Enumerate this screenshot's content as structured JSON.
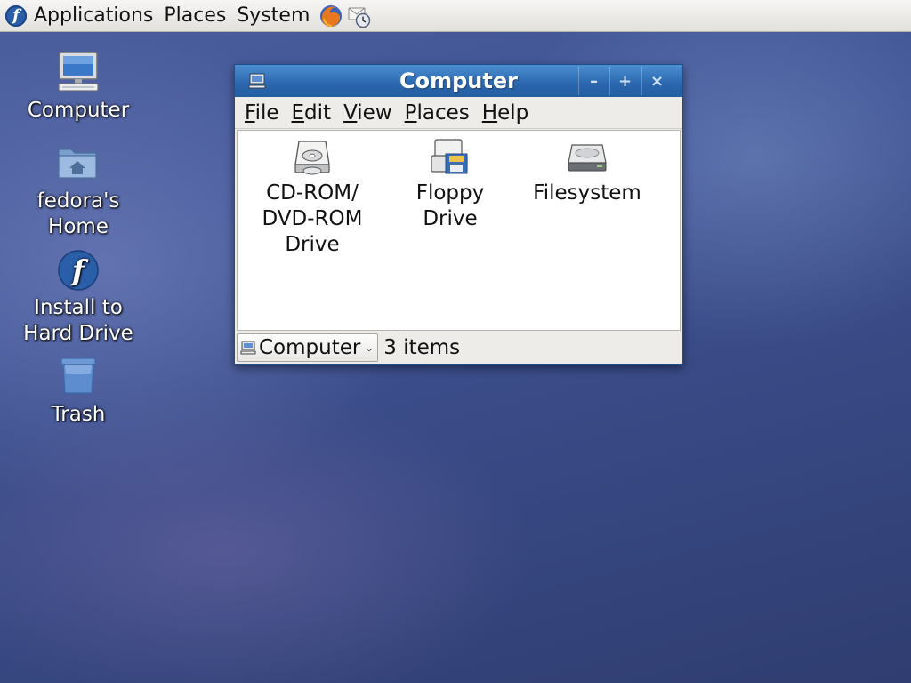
{
  "top_panel": {
    "menus": [
      "Applications",
      "Places",
      "System"
    ]
  },
  "desktop": {
    "icons": [
      {
        "label": "Computer",
        "icon": "computer-icon"
      },
      {
        "label": "fedora's\nHome",
        "icon": "home-folder-icon"
      },
      {
        "label": "Install to\nHard Drive",
        "icon": "fedora-logo-icon"
      },
      {
        "label": "Trash",
        "icon": "trash-icon"
      }
    ]
  },
  "window": {
    "title": "Computer",
    "menubar": [
      {
        "accel": "F",
        "rest": "ile"
      },
      {
        "accel": "E",
        "rest": "dit"
      },
      {
        "accel": "V",
        "rest": "iew"
      },
      {
        "accel": "P",
        "rest": "laces"
      },
      {
        "accel": "H",
        "rest": "elp"
      }
    ],
    "items": [
      {
        "label": "CD-ROM/\nDVD-ROM\nDrive",
        "icon": "cdrom-drive-icon"
      },
      {
        "label": "Floppy\nDrive",
        "icon": "floppy-drive-icon"
      },
      {
        "label": "Filesystem",
        "icon": "harddisk-icon"
      }
    ],
    "status": {
      "location": "Computer",
      "count": "3 items"
    }
  },
  "colors": {
    "titlebar": "#2a66ae",
    "panel": "#e3e1dd",
    "fedora_blue": "#2a5ea8"
  }
}
